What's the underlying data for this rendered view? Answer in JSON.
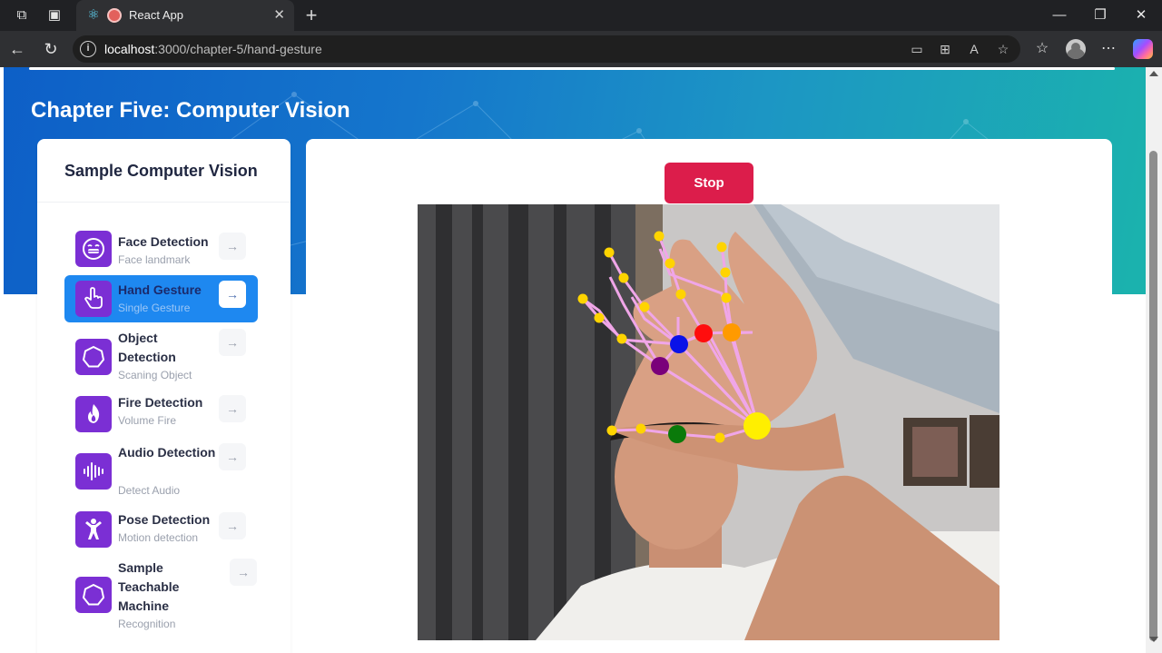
{
  "browser": {
    "tab_title": "React App",
    "url_host": "localhost",
    "url_path": ":3000/chapter-5/hand-gesture"
  },
  "page": {
    "title": "Chapter Five: Computer Vision"
  },
  "sidebar": {
    "title": "Sample Computer Vision",
    "active_index": 1,
    "items": [
      {
        "title": "Face Detection",
        "subtitle": "Face landmark",
        "icon": "smile-icon"
      },
      {
        "title": "Hand Gesture",
        "subtitle": "Single Gesture",
        "icon": "hand-pointer-icon"
      },
      {
        "title": "Object Detection",
        "subtitle": "Scaning Object",
        "icon": "heptagon-icon"
      },
      {
        "title": "Fire Detection",
        "subtitle": "Volume Fire",
        "icon": "fire-icon"
      },
      {
        "title": "Audio Detection",
        "subtitle": "Detect Audio",
        "icon": "audio-wave-icon"
      },
      {
        "title": "Pose Detection",
        "subtitle": "Motion detection",
        "icon": "person-icon"
      },
      {
        "title": "Sample Teachable Machine",
        "subtitle": "Recognition",
        "icon": "heptagon-icon"
      }
    ]
  },
  "main": {
    "stop_label": "Stop"
  },
  "colors": {
    "accent_blue": "#1e88f0",
    "icon_purple": "#7b2fd4",
    "stop_red": "#dc1d4b",
    "landmark_yellow": "#ffd400",
    "skeleton_pink": "#f0a6e8"
  }
}
